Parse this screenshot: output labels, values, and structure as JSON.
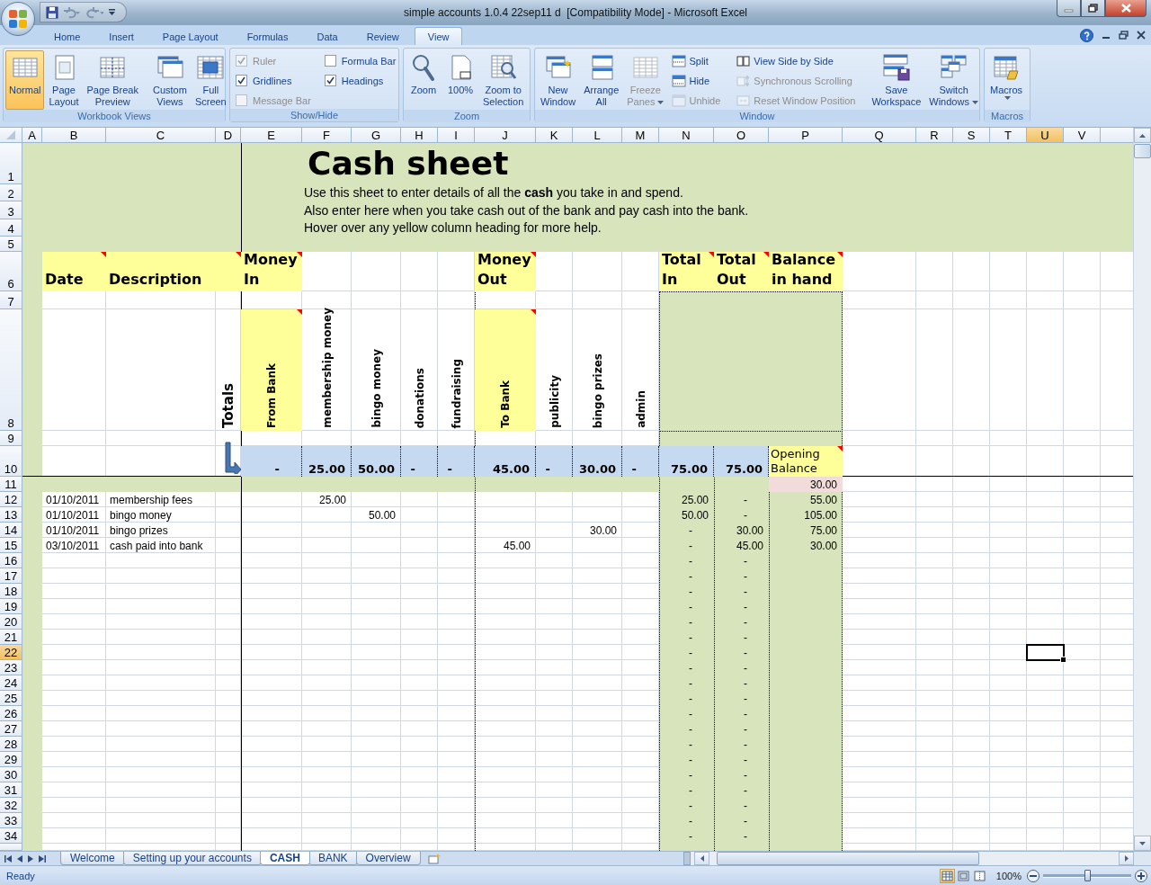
{
  "window": {
    "title": "simple accounts 1.0.4 22sep11 d  [Compatibility Mode] - Microsoft Excel"
  },
  "ribbon_tabs": [
    {
      "label": "Home",
      "selected": false
    },
    {
      "label": "Insert",
      "selected": false
    },
    {
      "label": "Page Layout",
      "selected": false
    },
    {
      "label": "Formulas",
      "selected": false
    },
    {
      "label": "Data",
      "selected": false
    },
    {
      "label": "Review",
      "selected": false
    },
    {
      "label": "View",
      "selected": true
    }
  ],
  "ribbon_groups": [
    {
      "title": "Workbook Views",
      "items": [
        {
          "kind": "large",
          "label": "Normal",
          "selected": true,
          "disabled": false,
          "menu": false
        },
        {
          "kind": "large",
          "label": "Page\nLayout",
          "selected": false,
          "disabled": false,
          "menu": false
        },
        {
          "kind": "large",
          "label": "Page Break\nPreview",
          "selected": false,
          "disabled": false,
          "menu": false
        },
        {
          "kind": "large",
          "label": "Custom\nViews",
          "selected": false,
          "disabled": false,
          "menu": false
        },
        {
          "kind": "large",
          "label": "Full\nScreen",
          "selected": false,
          "disabled": false,
          "menu": false
        }
      ]
    },
    {
      "title": "Show/Hide",
      "items": [
        {
          "kind": "check",
          "label": "Ruler",
          "checked": true,
          "disabled": true
        },
        {
          "kind": "check",
          "label": "Gridlines",
          "checked": true,
          "disabled": false
        },
        {
          "kind": "check",
          "label": "Message Bar",
          "checked": false,
          "disabled": true
        },
        {
          "kind": "check",
          "label": "Formula Bar",
          "checked": false,
          "disabled": false
        },
        {
          "kind": "check",
          "label": "Headings",
          "checked": true,
          "disabled": false
        }
      ]
    },
    {
      "title": "Zoom",
      "items": [
        {
          "kind": "large",
          "label": "Zoom",
          "selected": false,
          "disabled": false,
          "menu": false
        },
        {
          "kind": "large",
          "label": "100%",
          "selected": false,
          "disabled": false,
          "menu": false
        },
        {
          "kind": "large",
          "label": "Zoom to\nSelection",
          "selected": false,
          "disabled": false,
          "menu": false
        }
      ]
    },
    {
      "title": "Window",
      "items": [
        {
          "kind": "large",
          "label": "New\nWindow",
          "selected": false,
          "disabled": false,
          "menu": false
        },
        {
          "kind": "large",
          "label": "Arrange\nAll",
          "selected": false,
          "disabled": false,
          "menu": false
        },
        {
          "kind": "large",
          "label": "Freeze\nPanes",
          "selected": false,
          "disabled": true,
          "menu": true
        },
        {
          "kind": "small",
          "label": "Split",
          "disabled": false
        },
        {
          "kind": "small",
          "label": "Hide",
          "disabled": false
        },
        {
          "kind": "small",
          "label": "Unhide",
          "disabled": true
        },
        {
          "kind": "small",
          "label": "View Side by Side",
          "disabled": false
        },
        {
          "kind": "small",
          "label": "Synchronous Scrolling",
          "disabled": true
        },
        {
          "kind": "small",
          "label": "Reset Window Position",
          "disabled": true
        },
        {
          "kind": "large",
          "label": "Save\nWorkspace",
          "selected": false,
          "disabled": false,
          "menu": false
        },
        {
          "kind": "large",
          "label": "Switch\nWindows",
          "selected": false,
          "disabled": false,
          "menu": true
        }
      ]
    },
    {
      "title": "Macros",
      "items": [
        {
          "kind": "large",
          "label": "Macros",
          "selected": false,
          "disabled": false,
          "menu": true
        }
      ]
    }
  ],
  "sheet": {
    "column_headers": [
      {
        "label": "A",
        "selected": false
      },
      {
        "label": "B",
        "selected": false
      },
      {
        "label": "C",
        "selected": false
      },
      {
        "label": "D",
        "selected": false
      },
      {
        "label": "E",
        "selected": false
      },
      {
        "label": "F",
        "selected": false
      },
      {
        "label": "G",
        "selected": false
      },
      {
        "label": "H",
        "selected": false
      },
      {
        "label": "I",
        "selected": false
      },
      {
        "label": "J",
        "selected": false
      },
      {
        "label": "K",
        "selected": false
      },
      {
        "label": "L",
        "selected": false
      },
      {
        "label": "M",
        "selected": false
      },
      {
        "label": "N",
        "selected": false
      },
      {
        "label": "O",
        "selected": false
      },
      {
        "label": "P",
        "selected": false
      },
      {
        "label": "Q",
        "selected": false
      },
      {
        "label": "R",
        "selected": false
      },
      {
        "label": "S",
        "selected": false
      },
      {
        "label": "T",
        "selected": false
      },
      {
        "label": "U",
        "selected": true
      },
      {
        "label": "V",
        "selected": false
      }
    ],
    "row_headers": [
      {
        "label": "1",
        "selected": false
      },
      {
        "label": "2",
        "selected": false
      },
      {
        "label": "3",
        "selected": false
      },
      {
        "label": "4",
        "selected": false
      },
      {
        "label": "5",
        "selected": false
      },
      {
        "label": "6",
        "selected": false
      },
      {
        "label": "7",
        "selected": false
      },
      {
        "label": "8",
        "selected": false
      },
      {
        "label": "9",
        "selected": false
      },
      {
        "label": "10",
        "selected": false
      },
      {
        "label": "11",
        "selected": false
      },
      {
        "label": "12",
        "selected": false
      },
      {
        "label": "13",
        "selected": false
      },
      {
        "label": "14",
        "selected": false
      },
      {
        "label": "15",
        "selected": false
      },
      {
        "label": "16",
        "selected": false
      },
      {
        "label": "17",
        "selected": false
      },
      {
        "label": "18",
        "selected": false
      },
      {
        "label": "19",
        "selected": false
      },
      {
        "label": "20",
        "selected": false
      },
      {
        "label": "21",
        "selected": false
      },
      {
        "label": "22",
        "selected": true
      },
      {
        "label": "23",
        "selected": false
      },
      {
        "label": "24",
        "selected": false
      },
      {
        "label": "25",
        "selected": false
      },
      {
        "label": "26",
        "selected": false
      },
      {
        "label": "27",
        "selected": false
      },
      {
        "label": "28",
        "selected": false
      },
      {
        "label": "29",
        "selected": false
      },
      {
        "label": "30",
        "selected": false
      },
      {
        "label": "31",
        "selected": false
      },
      {
        "label": "32",
        "selected": false
      },
      {
        "label": "33",
        "selected": false
      },
      {
        "label": "34",
        "selected": false
      }
    ],
    "title": "Cash sheet",
    "intro": [
      "Use this sheet to enter details of all the **cash** you take in and spend.",
      "Also enter here when you take cash out of the bank and pay cash into the bank.",
      "Hover over any yellow column heading for more help."
    ],
    "headings": [
      {
        "label": "Date",
        "comment": true
      },
      {
        "label": "Description",
        "comment": true
      },
      {
        "label": "Money In",
        "comment": true
      },
      {
        "label": "Money Out",
        "comment": true
      },
      {
        "label": "Total In",
        "comment": true
      },
      {
        "label": "Total Out",
        "comment": true
      },
      {
        "label": "Balance in hand",
        "comment": true
      }
    ],
    "totals_label": "Totals",
    "categories": [
      {
        "label": "From Bank",
        "highlighted": true
      },
      {
        "label": "membership money",
        "highlighted": false
      },
      {
        "label": "bingo money",
        "highlighted": false
      },
      {
        "label": "donations",
        "highlighted": false
      },
      {
        "label": "fundraising",
        "highlighted": false
      },
      {
        "label": "To Bank",
        "highlighted": true
      },
      {
        "label": "publicity",
        "highlighted": false
      },
      {
        "label": "bingo prizes",
        "highlighted": false
      },
      {
        "label": "admin",
        "highlighted": false
      }
    ],
    "column_totals": [
      "-",
      "25.00",
      "50.00",
      "-",
      "-",
      "45.00",
      "-",
      "30.00",
      "-"
    ],
    "total_in": "75.00",
    "total_out": "75.00",
    "opening_balance_label": {
      "label": "Opening Balance",
      "comment": true
    },
    "opening_balance": "30.00",
    "entries": [
      {
        "date": "01/10/2011",
        "description": "membership fees",
        "membership_money": "25.00",
        "total_in": "25.00",
        "total_out": "-",
        "balance": "55.00"
      },
      {
        "date": "01/10/2011",
        "description": "bingo money",
        "bingo_money": "50.00",
        "total_in": "50.00",
        "total_out": "-",
        "balance": "105.00"
      },
      {
        "date": "01/10/2011",
        "description": "bingo prizes",
        "bingo_prizes": "30.00",
        "total_in": "-",
        "total_out": "30.00",
        "balance": "75.00"
      },
      {
        "date": "03/10/2011",
        "description": "cash paid into bank",
        "to_bank": "45.00",
        "total_in": "-",
        "total_out": "45.00",
        "balance": "30.00"
      },
      {
        "total_in": "-",
        "total_out": "-"
      },
      {
        "total_in": "-",
        "total_out": "-"
      },
      {
        "total_in": "-",
        "total_out": "-"
      },
      {
        "total_in": "-",
        "total_out": "-"
      },
      {
        "total_in": "-",
        "total_out": "-"
      },
      {
        "total_in": "-",
        "total_out": "-"
      },
      {
        "total_in": "-",
        "total_out": "-"
      },
      {
        "total_in": "-",
        "total_out": "-"
      },
      {
        "total_in": "-",
        "total_out": "-"
      },
      {
        "total_in": "-",
        "total_out": "-"
      },
      {
        "total_in": "-",
        "total_out": "-"
      },
      {
        "total_in": "-",
        "total_out": "-"
      },
      {
        "total_in": "-",
        "total_out": "-"
      },
      {
        "total_in": "-",
        "total_out": "-"
      },
      {
        "total_in": "-",
        "total_out": "-"
      },
      {
        "total_in": "-",
        "total_out": "-"
      },
      {
        "total_in": "-",
        "total_out": "-"
      },
      {
        "total_in": "-",
        "total_out": "-"
      },
      {
        "total_in": "-",
        "total_out": "-"
      }
    ]
  },
  "sheet_tabs": [
    {
      "label": "Welcome",
      "selected": false
    },
    {
      "label": "Setting up your accounts",
      "selected": false
    },
    {
      "label": "CASH",
      "selected": true
    },
    {
      "label": "BANK",
      "selected": false
    },
    {
      "label": "Overview",
      "selected": false
    }
  ],
  "status_bar": {
    "status": "Ready",
    "zoom": "100%",
    "zoom_slider": {
      "level": 0.5
    },
    "views": [
      {
        "selected": true
      },
      {
        "selected": false
      },
      {
        "selected": false
      }
    ]
  }
}
